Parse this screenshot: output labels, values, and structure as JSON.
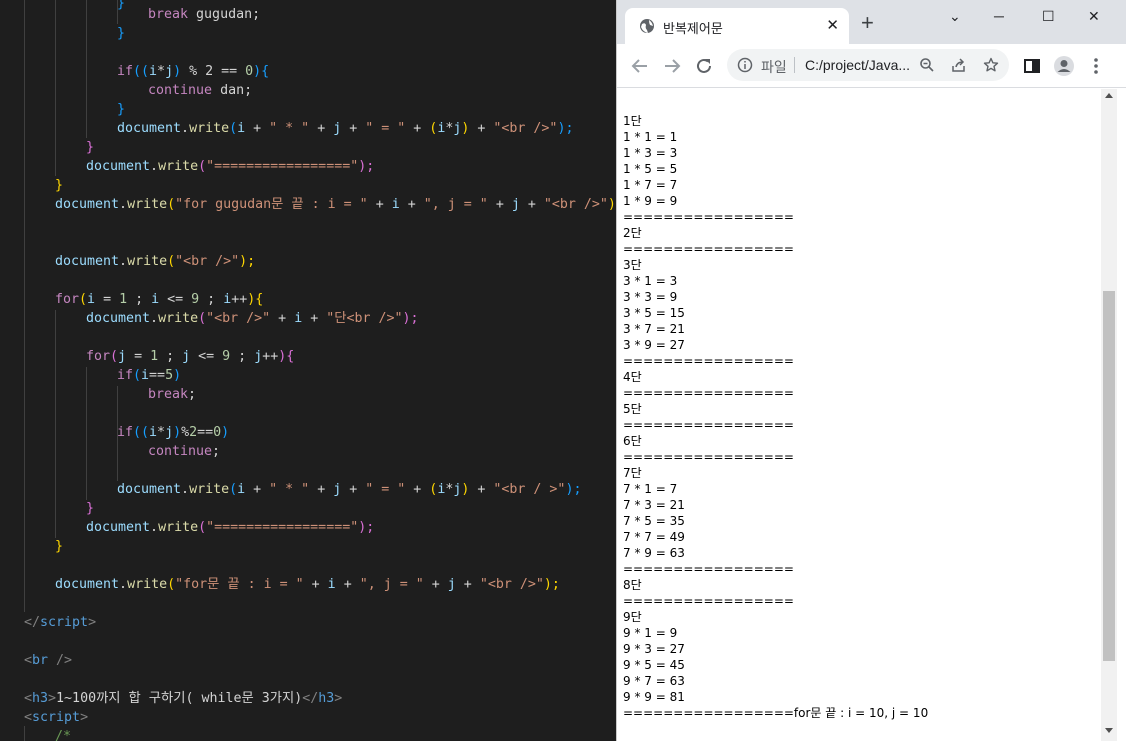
{
  "editor": {
    "lines": [
      [
        {
          "t": "}",
          "c": "b3"
        }
      ],
      [
        {
          "t": "break ",
          "c": "kw"
        },
        {
          "t": "gugudan;",
          "c": "tx"
        }
      ],
      [
        {
          "t": "}",
          "c": "b3"
        }
      ],
      [],
      [
        {
          "t": "if",
          "c": "kw"
        },
        {
          "t": "((",
          "c": "b3"
        },
        {
          "t": "i",
          "c": "id"
        },
        {
          "t": "*",
          "c": "op"
        },
        {
          "t": "j",
          "c": "id"
        },
        {
          "t": ") ",
          "c": "b3"
        },
        {
          "t": "% 2 == ",
          "c": "op"
        },
        {
          "t": "0",
          "c": "nu"
        },
        {
          "t": "){",
          "c": "b3"
        }
      ],
      [
        {
          "t": "continue ",
          "c": "kw"
        },
        {
          "t": "dan;",
          "c": "tx"
        }
      ],
      [
        {
          "t": "}",
          "c": "b3"
        }
      ],
      [
        {
          "t": "document",
          "c": "id"
        },
        {
          "t": ".",
          "c": "op"
        },
        {
          "t": "write",
          "c": "fn"
        },
        {
          "t": "(",
          "c": "b3"
        },
        {
          "t": "i ",
          "c": "id"
        },
        {
          "t": "+ ",
          "c": "op"
        },
        {
          "t": "\" * \" ",
          "c": "st"
        },
        {
          "t": "+ ",
          "c": "op"
        },
        {
          "t": "j ",
          "c": "id"
        },
        {
          "t": "+ ",
          "c": "op"
        },
        {
          "t": "\" = \" ",
          "c": "st"
        },
        {
          "t": "+ ",
          "c": "op"
        },
        {
          "t": "(",
          "c": "b1"
        },
        {
          "t": "i",
          "c": "id"
        },
        {
          "t": "*",
          "c": "op"
        },
        {
          "t": "j",
          "c": "id"
        },
        {
          "t": ") ",
          "c": "b1"
        },
        {
          "t": "+ ",
          "c": "op"
        },
        {
          "t": "\"<br />\"",
          "c": "st"
        },
        {
          "t": ");",
          "c": "b3"
        }
      ],
      [
        {
          "t": "}",
          "c": "b2"
        }
      ],
      [
        {
          "t": "document",
          "c": "id"
        },
        {
          "t": ".",
          "c": "op"
        },
        {
          "t": "write",
          "c": "fn"
        },
        {
          "t": "(",
          "c": "b2"
        },
        {
          "t": "\"=================\"",
          "c": "st"
        },
        {
          "t": ");",
          "c": "b2"
        }
      ],
      [
        {
          "t": "}",
          "c": "b1"
        }
      ],
      [
        {
          "t": "document",
          "c": "id"
        },
        {
          "t": ".",
          "c": "op"
        },
        {
          "t": "write",
          "c": "fn"
        },
        {
          "t": "(",
          "c": "b1"
        },
        {
          "t": "\"for gugudan문 끝 : i = \" ",
          "c": "st"
        },
        {
          "t": "+ ",
          "c": "op"
        },
        {
          "t": "i ",
          "c": "id"
        },
        {
          "t": "+ ",
          "c": "op"
        },
        {
          "t": "\", j = \" ",
          "c": "st"
        },
        {
          "t": "+ ",
          "c": "op"
        },
        {
          "t": "j ",
          "c": "id"
        },
        {
          "t": "+ ",
          "c": "op"
        },
        {
          "t": "\"<br />\"",
          "c": "st"
        },
        {
          "t": ");",
          "c": "b1"
        }
      ],
      [],
      [],
      [
        {
          "t": "document",
          "c": "id"
        },
        {
          "t": ".",
          "c": "op"
        },
        {
          "t": "write",
          "c": "fn"
        },
        {
          "t": "(",
          "c": "b1"
        },
        {
          "t": "\"<br />\"",
          "c": "st"
        },
        {
          "t": ");",
          "c": "b1"
        }
      ],
      [],
      [
        {
          "t": "for",
          "c": "kw"
        },
        {
          "t": "(",
          "c": "b1"
        },
        {
          "t": "i ",
          "c": "id"
        },
        {
          "t": "= ",
          "c": "op"
        },
        {
          "t": "1 ",
          "c": "nu"
        },
        {
          "t": "; ",
          "c": "op"
        },
        {
          "t": "i ",
          "c": "id"
        },
        {
          "t": "<= ",
          "c": "op"
        },
        {
          "t": "9 ",
          "c": "nu"
        },
        {
          "t": "; ",
          "c": "op"
        },
        {
          "t": "i",
          "c": "id"
        },
        {
          "t": "++",
          "c": "op"
        },
        {
          "t": "){",
          "c": "b1"
        }
      ],
      [
        {
          "t": "document",
          "c": "id"
        },
        {
          "t": ".",
          "c": "op"
        },
        {
          "t": "write",
          "c": "fn"
        },
        {
          "t": "(",
          "c": "b2"
        },
        {
          "t": "\"<br />\" ",
          "c": "st"
        },
        {
          "t": "+ ",
          "c": "op"
        },
        {
          "t": "i ",
          "c": "id"
        },
        {
          "t": "+ ",
          "c": "op"
        },
        {
          "t": "\"단<br />\"",
          "c": "st"
        },
        {
          "t": ");",
          "c": "b2"
        }
      ],
      [],
      [
        {
          "t": "for",
          "c": "kw"
        },
        {
          "t": "(",
          "c": "b2"
        },
        {
          "t": "j ",
          "c": "id"
        },
        {
          "t": "= ",
          "c": "op"
        },
        {
          "t": "1 ",
          "c": "nu"
        },
        {
          "t": "; ",
          "c": "op"
        },
        {
          "t": "j ",
          "c": "id"
        },
        {
          "t": "<= ",
          "c": "op"
        },
        {
          "t": "9 ",
          "c": "nu"
        },
        {
          "t": "; ",
          "c": "op"
        },
        {
          "t": "j",
          "c": "id"
        },
        {
          "t": "++",
          "c": "op"
        },
        {
          "t": "){",
          "c": "b2"
        }
      ],
      [
        {
          "t": "if",
          "c": "kw"
        },
        {
          "t": "(",
          "c": "b3"
        },
        {
          "t": "i",
          "c": "id"
        },
        {
          "t": "==",
          "c": "op"
        },
        {
          "t": "5",
          "c": "nu"
        },
        {
          "t": ")",
          "c": "b3"
        }
      ],
      [
        {
          "t": "break",
          "c": "kw"
        },
        {
          "t": ";",
          "c": "tx"
        }
      ],
      [],
      [
        {
          "t": "if",
          "c": "kw"
        },
        {
          "t": "((",
          "c": "b3"
        },
        {
          "t": "i",
          "c": "id"
        },
        {
          "t": "*",
          "c": "op"
        },
        {
          "t": "j",
          "c": "id"
        },
        {
          "t": ")",
          "c": "b3"
        },
        {
          "t": "%",
          "c": "op"
        },
        {
          "t": "2",
          "c": "nu"
        },
        {
          "t": "==",
          "c": "op"
        },
        {
          "t": "0",
          "c": "nu"
        },
        {
          "t": ")",
          "c": "b3"
        }
      ],
      [
        {
          "t": "continue",
          "c": "kw"
        },
        {
          "t": ";",
          "c": "tx"
        }
      ],
      [],
      [
        {
          "t": "document",
          "c": "id"
        },
        {
          "t": ".",
          "c": "op"
        },
        {
          "t": "write",
          "c": "fn"
        },
        {
          "t": "(",
          "c": "b3"
        },
        {
          "t": "i ",
          "c": "id"
        },
        {
          "t": "+ ",
          "c": "op"
        },
        {
          "t": "\" * \" ",
          "c": "st"
        },
        {
          "t": "+ ",
          "c": "op"
        },
        {
          "t": "j ",
          "c": "id"
        },
        {
          "t": "+ ",
          "c": "op"
        },
        {
          "t": "\" = \" ",
          "c": "st"
        },
        {
          "t": "+ ",
          "c": "op"
        },
        {
          "t": "(",
          "c": "b1"
        },
        {
          "t": "i",
          "c": "id"
        },
        {
          "t": "*",
          "c": "op"
        },
        {
          "t": "j",
          "c": "id"
        },
        {
          "t": ") ",
          "c": "b1"
        },
        {
          "t": "+ ",
          "c": "op"
        },
        {
          "t": "\"<br / >\"",
          "c": "st"
        },
        {
          "t": ");",
          "c": "b3"
        }
      ],
      [
        {
          "t": "}",
          "c": "b2"
        }
      ],
      [
        {
          "t": "document",
          "c": "id"
        },
        {
          "t": ".",
          "c": "op"
        },
        {
          "t": "write",
          "c": "fn"
        },
        {
          "t": "(",
          "c": "b2"
        },
        {
          "t": "\"=================\"",
          "c": "st"
        },
        {
          "t": ");",
          "c": "b2"
        }
      ],
      [
        {
          "t": "}",
          "c": "b1"
        }
      ],
      [],
      [
        {
          "t": "document",
          "c": "id"
        },
        {
          "t": ".",
          "c": "op"
        },
        {
          "t": "write",
          "c": "fn"
        },
        {
          "t": "(",
          "c": "b1"
        },
        {
          "t": "\"for문 끝 : i = \" ",
          "c": "st"
        },
        {
          "t": "+ ",
          "c": "op"
        },
        {
          "t": "i ",
          "c": "id"
        },
        {
          "t": "+ ",
          "c": "op"
        },
        {
          "t": "\", j = \" ",
          "c": "st"
        },
        {
          "t": "+ ",
          "c": "op"
        },
        {
          "t": "j ",
          "c": "id"
        },
        {
          "t": "+ ",
          "c": "op"
        },
        {
          "t": "\"<br />\"",
          "c": "st"
        },
        {
          "t": ");",
          "c": "b1"
        }
      ],
      [],
      [
        {
          "t": "</",
          "c": "tg"
        },
        {
          "t": "script",
          "c": "tn"
        },
        {
          "t": ">",
          "c": "tg"
        }
      ],
      [],
      [
        {
          "t": "<",
          "c": "tg"
        },
        {
          "t": "br ",
          "c": "tn"
        },
        {
          "t": "/>",
          "c": "tg"
        }
      ],
      [],
      [
        {
          "t": "<",
          "c": "tg"
        },
        {
          "t": "h3",
          "c": "tn"
        },
        {
          "t": ">",
          "c": "tg"
        },
        {
          "t": "1~100까지 합 구하기( while문 3가지)",
          "c": "tx"
        },
        {
          "t": "</",
          "c": "tg"
        },
        {
          "t": "h3",
          "c": "tn"
        },
        {
          "t": ">",
          "c": "tg"
        }
      ],
      [
        {
          "t": "<",
          "c": "tg"
        },
        {
          "t": "script",
          "c": "tn"
        },
        {
          "t": ">",
          "c": "tg"
        }
      ],
      [
        {
          "t": "/*",
          "c": "cm"
        }
      ]
    ]
  },
  "browser": {
    "tab_title": "반복제어문",
    "tab_close": "✕",
    "new_tab": "+",
    "win_min": "─",
    "win_max": "☐",
    "win_close": "✕",
    "win_tabsearch": "⌄",
    "scheme": "파일",
    "url": "C:/project/Java...",
    "output": [
      "",
      "1단",
      "1 * 1 = 1",
      "1 * 3 = 3",
      "1 * 5 = 5",
      "1 * 7 = 7",
      "1 * 9 = 9",
      "=================",
      "2단",
      "=================",
      "3단",
      "3 * 1 = 3",
      "3 * 3 = 9",
      "3 * 5 = 15",
      "3 * 7 = 21",
      "3 * 9 = 27",
      "=================",
      "4단",
      "=================",
      "5단",
      "=================",
      "6단",
      "=================",
      "7단",
      "7 * 1 = 7",
      "7 * 3 = 21",
      "7 * 5 = 35",
      "7 * 7 = 49",
      "7 * 9 = 63",
      "=================",
      "8단",
      "=================",
      "9단",
      "9 * 1 = 9",
      "9 * 3 = 27",
      "9 * 5 = 45",
      "9 * 7 = 63",
      "9 * 9 = 81",
      "=================for문 끝 : i = 10, j = 10"
    ]
  }
}
